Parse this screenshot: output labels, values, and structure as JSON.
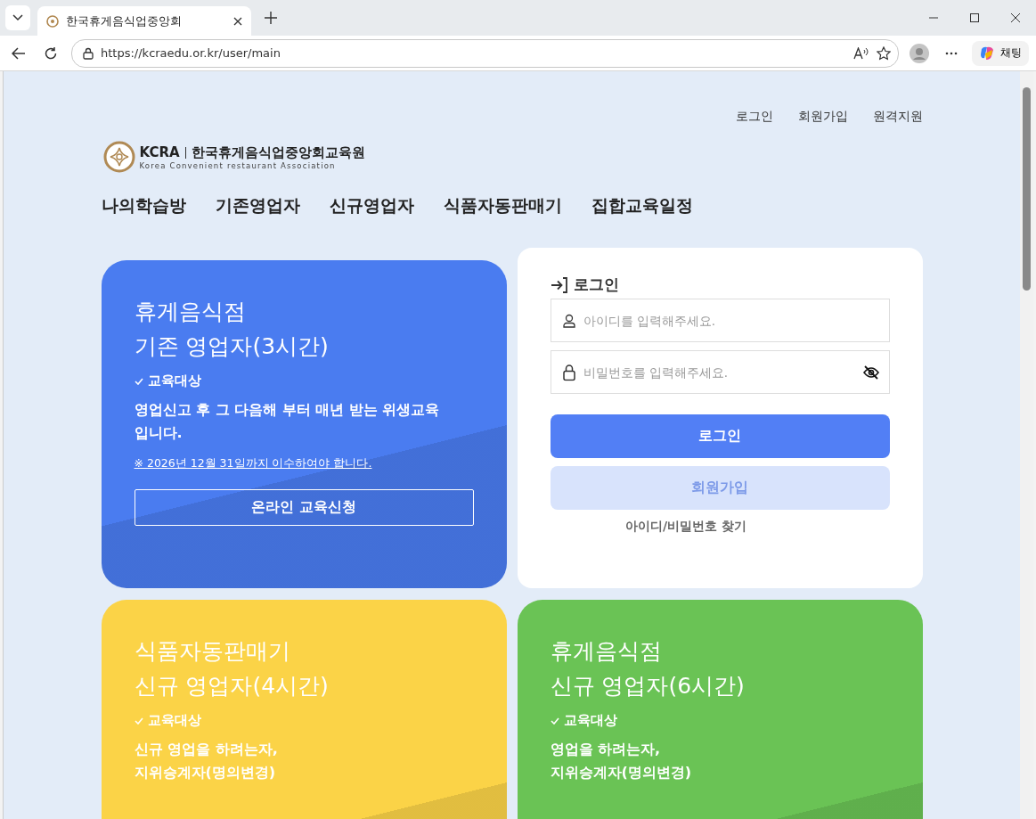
{
  "browser": {
    "tab_title": "한국휴게음식업중앙회",
    "url": "https://kcraedu.or.kr/user/main",
    "chat_label": "채팅"
  },
  "top_links": [
    "로그인",
    "회원가입",
    "원격지원"
  ],
  "logo": {
    "abbr": "KCRA",
    "name": "한국휴게음식업중앙회교육원",
    "subtitle": "Korea Convenient restaurant Association"
  },
  "nav": [
    "나의학습방",
    "기존영업자",
    "신규영업자",
    "식품자동판매기",
    "집합교육일정"
  ],
  "courses": [
    {
      "title": [
        "휴게음식점",
        "기존 영업자(3시간)"
      ],
      "target_label": "교육대상",
      "description": [
        "영업신고 후 그 다음해 부터 매년 받는 위생교육",
        "입니다."
      ],
      "note": "※ 2026년 12월 31일까지 이수하여야 합니다.",
      "button": "온라인 교육신청",
      "color": "#4a7cf0"
    },
    {
      "title": [
        "식품자동판매기",
        "신규 영업자(4시간)"
      ],
      "target_label": "교육대상",
      "description": [
        "신규 영업을 하려는자,",
        " 지위승계자(명의변경)"
      ],
      "color": "#fbd347"
    },
    {
      "title": [
        "휴게음식점",
        "신규 영업자(6시간)"
      ],
      "target_label": "교육대상",
      "description": [
        "영업을 하려는자,",
        "지위승계자(명의변경)"
      ],
      "color": "#6ac355"
    }
  ],
  "login": {
    "title": "로그인",
    "id_field": {
      "placeholder": "아이디를 입력해주세요."
    },
    "password_field": {
      "placeholder": "비밀번호를 입력해주세요."
    },
    "login_button": "로그인",
    "signup_button": "회원가입",
    "find_link": "아이디/비밀번호 찾기"
  }
}
